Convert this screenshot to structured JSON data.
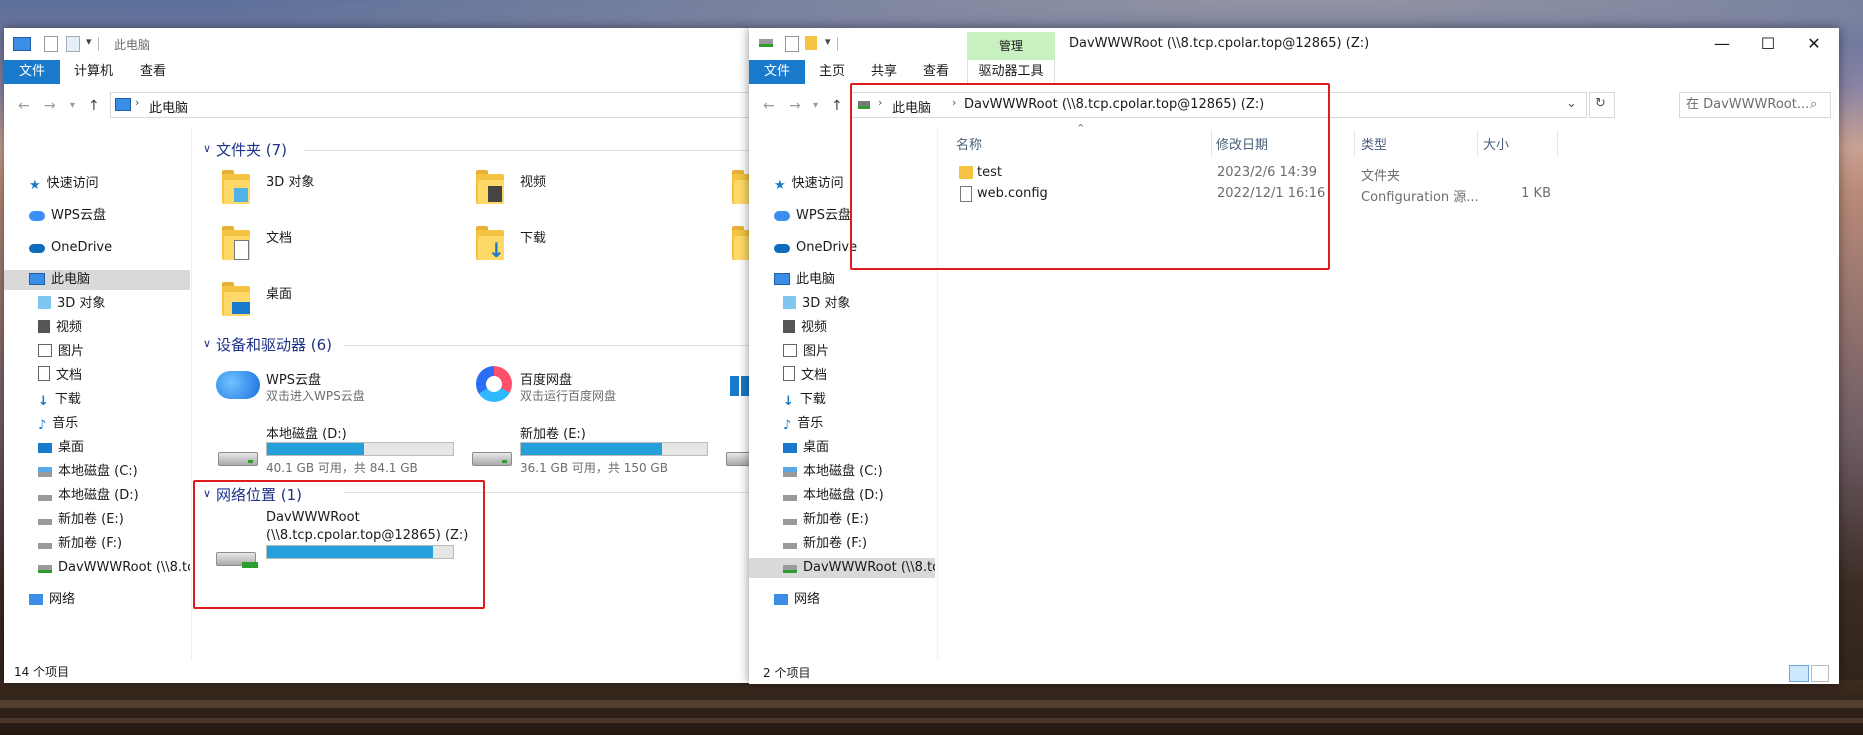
{
  "left_window": {
    "title": "此电脑",
    "ribbon_tabs": [
      "文件",
      "计算机",
      "查看"
    ],
    "breadcrumb": "此电脑",
    "nav": {
      "quick_access": "快速访问",
      "wps_cloud": "WPS云盘",
      "onedrive": "OneDrive",
      "this_pc": "此电脑",
      "objects3d": "3D 对象",
      "videos": "视频",
      "pictures": "图片",
      "documents": "文档",
      "downloads": "下载",
      "music": "音乐",
      "desktop": "桌面",
      "drive_c": "本地磁盘 (C:)",
      "drive_d": "本地磁盘 (D:)",
      "drive_e": "新加卷 (E:)",
      "drive_f": "新加卷 (F:)",
      "drive_z": "DavWWWRoot (\\\\8.tcp",
      "network": "网络"
    },
    "folders_header": "文件夹 (7)",
    "folders": {
      "objects3d": "3D 对象",
      "videos": "视频",
      "documents": "文档",
      "downloads": "下载",
      "desktop": "桌面"
    },
    "devices_header": "设备和驱动器 (6)",
    "devices": {
      "wps_name": "WPS云盘",
      "wps_desc": "双击进入WPS云盘",
      "baidu_name": "百度网盘",
      "baidu_desc": "双击运行百度网盘",
      "d_name": "本地磁盘 (D:)",
      "d_info": "40.1 GB 可用，共 84.1 GB",
      "d_used": 0.52,
      "e_name": "新加卷 (E:)",
      "e_info": "36.1 GB 可用，共 150 GB",
      "e_used": 0.76
    },
    "network_header": "网络位置 (1)",
    "network": {
      "name_line1": "DavWWWRoot",
      "name_line2": "(\\\\8.tcp.cpolar.top@12865) (Z:)",
      "used": 0.89
    },
    "status": "14 个项目"
  },
  "right_window": {
    "title": "DavWWWRoot (\\\\8.tcp.cpolar.top@12865) (Z:)",
    "manage_tab": "管理",
    "drive_tools_tab": "驱动器工具",
    "ribbon_tabs": [
      "文件",
      "主页",
      "共享",
      "查看"
    ],
    "breadcrumb": [
      "此电脑",
      "DavWWWRoot (\\\\8.tcp.cpolar.top@12865) (Z:)"
    ],
    "search_placeholder": "在 DavWWWRoot...",
    "columns": [
      "名称",
      "修改日期",
      "类型",
      "大小"
    ],
    "files": [
      {
        "name": "test",
        "date": "2023/2/6 14:39",
        "type": "文件夹",
        "size": ""
      },
      {
        "name": "web.config",
        "date": "2022/12/1 16:16",
        "type": "Configuration 源...",
        "size": "1 KB"
      }
    ],
    "nav": {
      "quick_access": "快速访问",
      "wps_cloud": "WPS云盘",
      "onedrive": "OneDrive",
      "this_pc": "此电脑",
      "objects3d": "3D 对象",
      "videos": "视频",
      "pictures": "图片",
      "documents": "文档",
      "downloads": "下载",
      "music": "音乐",
      "desktop": "桌面",
      "drive_c": "本地磁盘 (C:)",
      "drive_d": "本地磁盘 (D:)",
      "drive_e": "新加卷 (E:)",
      "drive_f": "新加卷 (F:)",
      "drive_z": "DavWWWRoot (\\\\8.tcp",
      "network": "网络"
    },
    "status": "2 个项目"
  },
  "colors": {
    "accent": "#1979ca",
    "highlight_box": "#e01b1b",
    "bar_fill": "#26a0da",
    "manage_tab_bg": "#c8f0c0"
  },
  "icons": [
    "computer-icon",
    "folder-icon",
    "star-icon",
    "cloud-icon",
    "drive-icon",
    "network-drive-icon",
    "network-icon",
    "search-icon",
    "refresh-icon"
  ]
}
